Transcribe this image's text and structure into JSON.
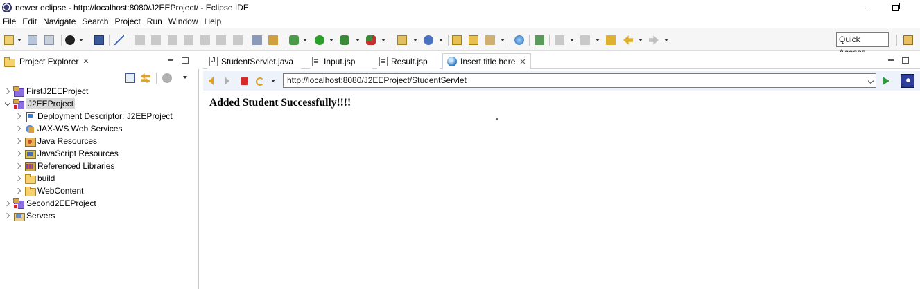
{
  "window": {
    "title": "newer eclipse - http://localhost:8080/J2EEProject/ - Eclipse IDE"
  },
  "menu": [
    "File",
    "Edit",
    "Navigate",
    "Search",
    "Project",
    "Run",
    "Window",
    "Help"
  ],
  "toolbar": {
    "quick_access": "Quick Access"
  },
  "project_explorer": {
    "tab_label": "Project Explorer",
    "tree": [
      {
        "label": "FirstJ2EEProject",
        "icon": "project-icon",
        "level": 0,
        "expanded": false,
        "error": false
      },
      {
        "label": "J2EEProject",
        "icon": "project-icon",
        "level": 0,
        "expanded": true,
        "error": true,
        "selected": true
      },
      {
        "label": "Deployment Descriptor: J2EEProject",
        "icon": "deployment-descriptor-icon",
        "level": 1,
        "expanded": false
      },
      {
        "label": "JAX-WS Web Services",
        "icon": "web-services-icon",
        "level": 1,
        "expanded": false
      },
      {
        "label": "Java Resources",
        "icon": "java-resources-icon",
        "level": 1,
        "expanded": false
      },
      {
        "label": "JavaScript Resources",
        "icon": "javascript-resources-icon",
        "level": 1,
        "expanded": false
      },
      {
        "label": "Referenced Libraries",
        "icon": "library-icon",
        "level": 1,
        "expanded": false
      },
      {
        "label": "build",
        "icon": "folder-icon",
        "level": 1,
        "expanded": false
      },
      {
        "label": "WebContent",
        "icon": "folder-icon",
        "level": 1,
        "expanded": false
      },
      {
        "label": "Second2EEProject",
        "icon": "project-icon",
        "level": 0,
        "expanded": false,
        "error": true
      },
      {
        "label": "Servers",
        "icon": "servers-folder-icon",
        "level": 0,
        "expanded": false
      }
    ]
  },
  "editor": {
    "tabs": [
      {
        "label": "StudentServlet.java",
        "icon": "java-file-icon",
        "active": false
      },
      {
        "label": "Input.jsp",
        "icon": "jsp-file-icon",
        "active": false
      },
      {
        "label": "Result.jsp",
        "icon": "jsp-file-icon",
        "active": false
      },
      {
        "label": "Insert title here",
        "icon": "globe-icon",
        "active": true
      }
    ],
    "url": "http://localhost:8080/J2EEProject/StudentServlet",
    "page_message": "Added Student Successfully!!!!"
  }
}
